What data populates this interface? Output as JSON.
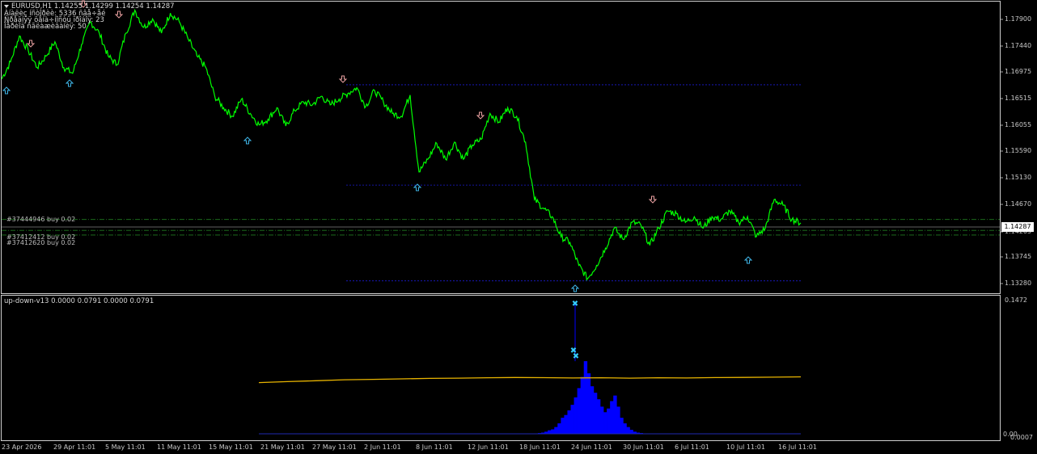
{
  "header": {
    "symbol_info": "EURUSD,H1  1.14255 1.14299 1.14254 1.14287",
    "line1": "Àíàëèç íñòîðèè: 5336 ñâå÷åé",
    "line2": "Ñðåäíÿÿ öåíà÷íîñòü ïðîáîÿ: 23",
    "line3": "Ïåðèîä ñãëàæèâàíèÿ: 50"
  },
  "trades": [
    {
      "label": "#37444946 buy 0.02",
      "price": 1.1435
    },
    {
      "label": "#37412412 buy 0.02",
      "price": 1.1416
    },
    {
      "label": "#37412620 buy 0.02",
      "price": 1.1408
    }
  ],
  "price_axis": {
    "ticks": [
      "1.17900",
      "1.17440",
      "1.16975",
      "1.16515",
      "1.16055",
      "1.15590",
      "1.15130",
      "1.14670",
      "1.14205",
      "1.13745",
      "1.13280"
    ],
    "current_price": "1.14287"
  },
  "time_axis": {
    "labels": [
      "23 Apr 2026",
      "29 Apr 11:01",
      "5 May 11:01",
      "11 May 11:01",
      "15 May 11:01",
      "21 May 11:01",
      "27 May 11:01",
      "2 Jun 11:01",
      "8 Jun 11:01",
      "12 Jun 11:01",
      "18 Jun 11:01",
      "24 Jun 11:01",
      "30 Jun 11:01",
      "6 Jul 11:01",
      "10 Jul 11:01",
      "16 Jul 11:01"
    ]
  },
  "indicator": {
    "label": "up-down-v13 0.0000 0.0791 0.0000 0.0791",
    "scale_top": "0.1472",
    "scale_bottom": "0.0007",
    "scale_bottom_overlap": "0.00"
  },
  "colors": {
    "price_line": "#00ff00",
    "level_line": "#1a1ad0",
    "trade_line": "#1f7a1f",
    "up_arrow": "#3fb6e8",
    "down_arrow": "#e8a0a0",
    "histogram": "#0000ff",
    "ma_line": "#e8b400",
    "peak_marker": "#33ccff"
  },
  "chart_data": {
    "type": "line",
    "y_range": [
      1.1305,
      1.1815
    ],
    "series": [
      {
        "values": [
          1.168,
          1.171,
          1.1755,
          1.173,
          1.17,
          1.172,
          1.1745,
          1.17,
          1.169,
          1.174,
          1.178,
          1.176,
          1.172,
          1.1705,
          1.176,
          1.18,
          1.177,
          1.1785,
          1.176,
          1.1795,
          1.178,
          1.175,
          1.172,
          1.17,
          1.165,
          1.163,
          1.1615,
          1.1645,
          1.162,
          1.16,
          1.161,
          1.163,
          1.1598,
          1.1625,
          1.164,
          1.1635,
          1.165,
          1.1635,
          1.1645,
          1.1655,
          1.1665,
          1.1632,
          1.166,
          1.164,
          1.162,
          1.1615,
          1.1652,
          1.1518,
          1.154,
          1.1568,
          1.154,
          1.157,
          1.154,
          1.1565,
          1.1575,
          1.162,
          1.1605,
          1.163,
          1.1615,
          1.157,
          1.147,
          1.1455,
          1.144,
          1.1405,
          1.1395,
          1.1355,
          1.1332,
          1.1355,
          1.1385,
          1.142,
          1.14,
          1.143,
          1.1425,
          1.139,
          1.142,
          1.145,
          1.1445,
          1.143,
          1.144,
          1.142,
          1.144,
          1.1435,
          1.145,
          1.143,
          1.144,
          1.1405,
          1.142,
          1.147,
          1.146,
          1.1435,
          1.1429
        ]
      }
    ]
  },
  "indicator_data": {
    "type": "bar",
    "y_range": [
      0.0007,
      0.1472
    ],
    "histogram": [
      0.0007,
      0.0008,
      0.001,
      0.0015,
      0.002,
      0.003,
      0.0045,
      0.0055,
      0.008,
      0.012,
      0.018,
      0.021,
      0.026,
      0.032,
      0.04,
      0.05,
      0.062,
      0.0791,
      0.066,
      0.052,
      0.045,
      0.038,
      0.03,
      0.024,
      0.028,
      0.036,
      0.042,
      0.03,
      0.018,
      0.012,
      0.008,
      0.005,
      0.003,
      0.002,
      0.0015,
      0.001,
      0.0008,
      0.0007
    ],
    "ma": [
      0.056,
      0.057,
      0.058,
      0.059,
      0.0595,
      0.06,
      0.0605,
      0.0608,
      0.0612,
      0.0615,
      0.0613,
      0.061,
      0.0612,
      0.0608,
      0.0612,
      0.061,
      0.0614,
      0.0616,
      0.0618,
      0.0622
    ]
  }
}
